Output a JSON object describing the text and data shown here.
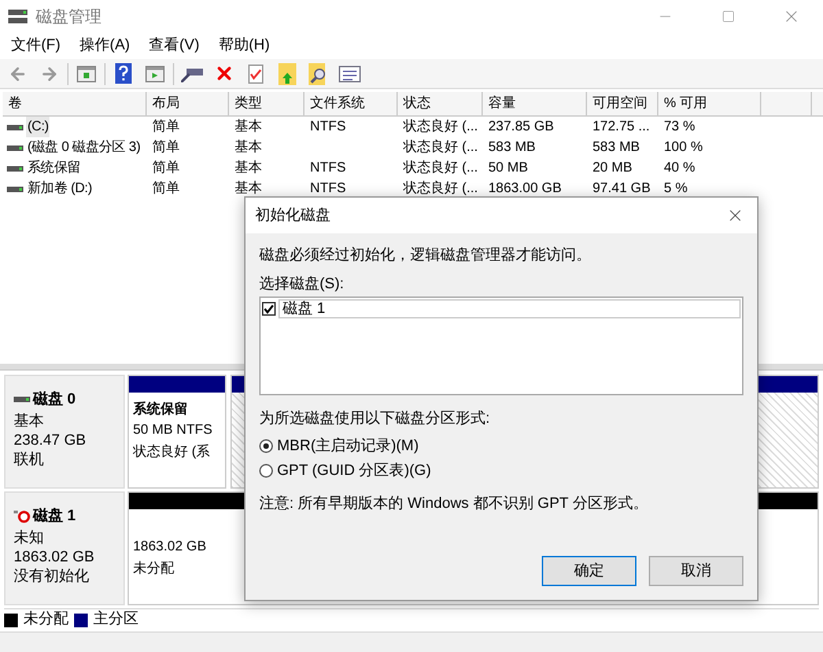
{
  "window": {
    "title": "磁盘管理"
  },
  "menu": [
    "文件(F)",
    "操作(A)",
    "查看(V)",
    "帮助(H)"
  ],
  "table": {
    "columns": [
      "卷",
      "布局",
      "类型",
      "文件系统",
      "状态",
      "容量",
      "可用空间",
      "% 可用"
    ],
    "rows": [
      {
        "cells": [
          "(C:)",
          "简单",
          "基本",
          "NTFS",
          "状态良好 (...",
          "237.85 GB",
          "172.75 ...",
          "73 %"
        ],
        "selected": true
      },
      {
        "cells": [
          "(磁盘 0 磁盘分区 3)",
          "简单",
          "基本",
          "",
          "状态良好 (...",
          "583 MB",
          "583 MB",
          "100 %"
        ],
        "selected": false
      },
      {
        "cells": [
          "系统保留",
          "简单",
          "基本",
          "NTFS",
          "状态良好 (...",
          "50 MB",
          "20 MB",
          "40 %"
        ],
        "selected": false
      },
      {
        "cells": [
          "新加卷 (D:)",
          "简单",
          "基本",
          "NTFS",
          "状态良好 (...",
          "1863.00 GB",
          "97.41 GB",
          "5 %"
        ],
        "selected": false
      }
    ]
  },
  "disks": [
    {
      "kind": "online",
      "name": "磁盘 0",
      "lines": [
        "基本",
        "238.47 GB",
        "联机"
      ],
      "partitions": [
        {
          "color": "#000080",
          "hatched": false,
          "title": "系统保留",
          "lines": [
            "50 MB NTFS",
            "状态良好 (系"
          ]
        },
        {
          "color": "#000080",
          "hatched": true
        }
      ]
    },
    {
      "kind": "uninitialized",
      "name": "磁盘 1",
      "lines": [
        "未知",
        "1863.02 GB",
        "没有初始化"
      ],
      "partitions": [
        {
          "color": "#000000",
          "hatched": false,
          "lines": [
            "1863.02 GB",
            "未分配"
          ]
        }
      ]
    }
  ],
  "legend": [
    {
      "label": "未分配",
      "color": "#000000"
    },
    {
      "label": "主分区",
      "color": "#000080"
    }
  ],
  "dialog": {
    "title": "初始化磁盘",
    "message": "磁盘必须经过初始化，逻辑磁盘管理器才能访问。",
    "select_label": "选择磁盘(S):",
    "disks": [
      {
        "label": "磁盘 1",
        "checked": true
      }
    ],
    "style_label": "为所选磁盘使用以下磁盘分区形式:",
    "options": [
      {
        "label": "MBR(主启动记录)(M)",
        "selected": true
      },
      {
        "label": "GPT (GUID 分区表)(G)",
        "selected": false
      }
    ],
    "note": "注意: 所有早期版本的 Windows 都不识别 GPT 分区形式。",
    "buttons": [
      {
        "label": "确定",
        "default": true
      },
      {
        "label": "取消",
        "default": false
      }
    ]
  }
}
